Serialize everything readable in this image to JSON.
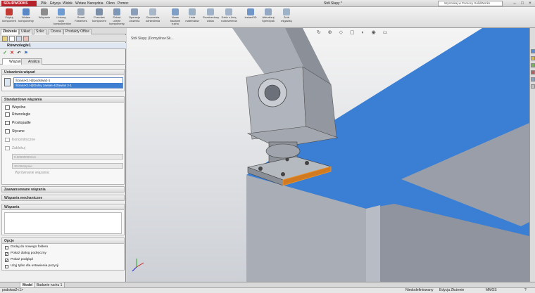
{
  "app": {
    "logo": "SOLIDWORKS",
    "document_title": "Stół Słupy *",
    "search_placeholder": "Wyszukaj w Pomocy SolidWorks"
  },
  "menu": [
    "Plik",
    "Edycja",
    "Widok",
    "Wstaw",
    "Narzędzia",
    "Okno",
    "Pomoc"
  ],
  "ribbon": [
    {
      "label": "Edytuj komponent",
      "icon": "edit-component-icon",
      "color": "#c23a33"
    },
    {
      "label": "Wstaw komponenty",
      "icon": "insert-component-icon",
      "color": "#5a87c5"
    },
    {
      "label": "Wiązanie",
      "icon": "mate-icon",
      "color": "#8c8c8c"
    },
    {
      "label": "Liniowy szyk komponentów",
      "icon": "linear-pattern-icon",
      "color": "#6f9bd3"
    },
    {
      "label": "Smart Fasteners",
      "icon": "smart-fasteners-icon",
      "color": "#9aa7b8"
    },
    {
      "label": "Przenieś komponent",
      "icon": "move-component-icon",
      "color": "#7b8ea8"
    },
    {
      "label": "Pokaż ukryte komponenty",
      "icon": "show-hidden-icon",
      "color": "#7e97b6"
    },
    {
      "label": "Operacje złożenia",
      "icon": "assembly-features-icon",
      "color": "#8c9fb8"
    },
    {
      "label": "Geometria odniesienia",
      "icon": "reference-geometry-icon",
      "color": "#a8b7c8"
    },
    {
      "label": "Nowe badanie ruchu",
      "icon": "motion-study-icon",
      "color": "#7fa0c6"
    },
    {
      "label": "Lista materiałów",
      "icon": "bom-icon",
      "color": "#9bb0c5"
    },
    {
      "label": "Rozstrzelony widok",
      "icon": "exploded-view-icon",
      "color": "#a0b2c7"
    },
    {
      "label": "Szkic z linią rozstrzelenia",
      "icon": "explode-line-sketch-icon",
      "color": "#a3b4c8"
    },
    {
      "label": "Instant3D",
      "icon": "instant3d-icon",
      "color": "#6f95c9"
    },
    {
      "label": "Aktualizuj Speedpak",
      "icon": "speedpak-icon",
      "color": "#93a9c3"
    },
    {
      "label": "Zrób migawkę",
      "icon": "snapshot-icon",
      "color": "#9fb3c8"
    }
  ],
  "command_tabs": [
    "Złożenie",
    "Układ",
    "Szkic",
    "Ocena",
    "Produkty Office"
  ],
  "property_manager": {
    "title": "Równoległe1",
    "subtabs": [
      "Wiązania",
      "Analiza"
    ],
    "selections": {
      "header": "Ustawienia wiązań",
      "items": [
        "Ściana<1>@podstwa2-1",
        "Ściana<1>@Dolny zawias-4/Zawias 2-1"
      ]
    },
    "standard": {
      "header": "Standardowe wiązania",
      "items": [
        {
          "label": "Wspólne",
          "enabled": true
        },
        {
          "label": "Równoległe",
          "enabled": true
        },
        {
          "label": "Prostopadłe",
          "enabled": true
        },
        {
          "label": "Styczne",
          "enabled": true
        },
        {
          "label": "Koncentryczne",
          "enabled": false
        },
        {
          "label": "Zablokuj",
          "enabled": false
        }
      ],
      "distance": "0.00000000mm",
      "angle": "30.00stopnie",
      "alignment_label": "Wyrównanie wiązania:"
    },
    "collapsed_groups": [
      "Zaawansowane wiązania",
      "Wiązania mechaniczne"
    ],
    "mates_list_header": "Wiązania",
    "options": {
      "header": "Opcje",
      "items": [
        {
          "label": "Dodaj do nowego folderu",
          "checked": false
        },
        {
          "label": "Pokaż dialog podręczny",
          "checked": true
        },
        {
          "label": "Pokaż podgląd",
          "checked": true
        },
        {
          "label": "Użyj tylko dla ustawienia pozycji",
          "checked": false
        }
      ]
    }
  },
  "viewport": {
    "breadcrumb": "Stół Słupy (Domyślna<Sk...",
    "heads_up": "↻ ⊕ ◇ ▢ ◐ ◉ ▭"
  },
  "bottom_tabs": [
    "Model",
    "Badanie ruchu 1"
  ],
  "status": {
    "left": "podstwa2<1>",
    "definition": "Niedodefiniowany",
    "mode": "Edycja Złożenie",
    "units": "MMGS",
    "help": "?"
  },
  "colors": {
    "accent": "#3a7ed1",
    "blue_face": "#3a7fd4",
    "part_gray": "#9ea2ab"
  }
}
